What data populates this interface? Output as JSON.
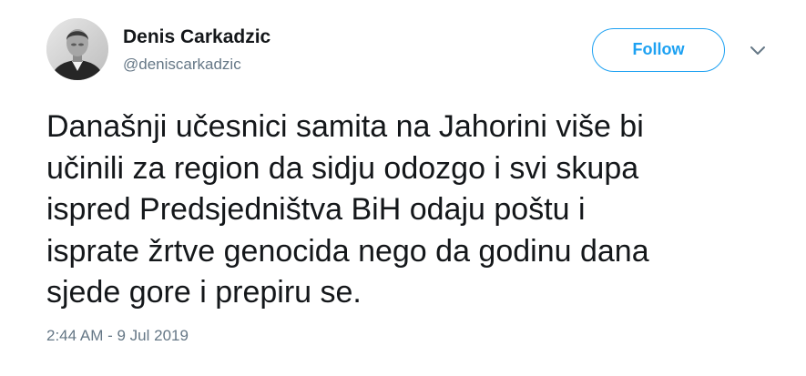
{
  "author": {
    "display_name": "Denis Carkadzic",
    "username": "@deniscarkadzic"
  },
  "follow_button": {
    "label": "Follow"
  },
  "tweet": {
    "lines": [
      "Današnji učesnici samita na Jahorini više bi",
      "učinili za region da sidju odozgo i svi skupa",
      "ispred Predsjedništva BiH odaju poštu i",
      "isprate žrtve genocida nego da godinu dana",
      "sjede gore i prepiru se."
    ],
    "timestamp": "2:44 AM - 9 Jul 2019"
  },
  "colors": {
    "accent": "#1da1f2",
    "text": "#14171a",
    "secondary_text": "#657786"
  },
  "icons": {
    "caret": "chevron-down-icon"
  }
}
